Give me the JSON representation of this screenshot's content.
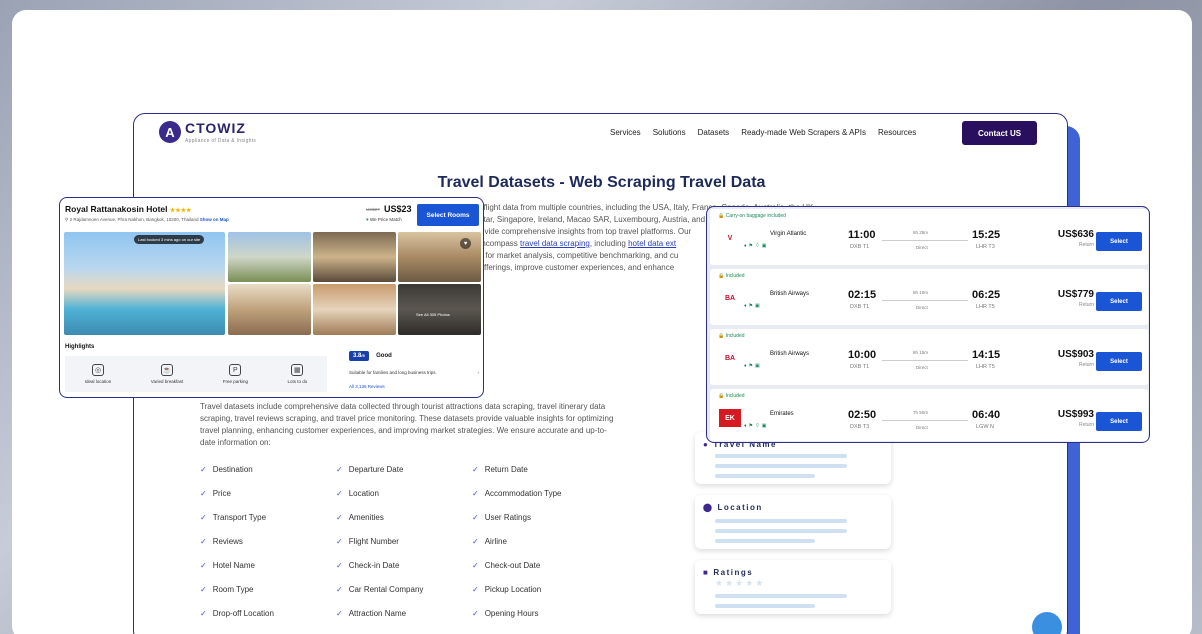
{
  "nav": {
    "logo_mark": "A",
    "logo_name": "CTOWIZ",
    "logo_tagline": "Appliance of Data & Insights",
    "links": [
      "Services",
      "Solutions",
      "Datasets",
      "Ready-made Web Scrapers & APIs",
      "Resources"
    ],
    "cta": "Contact US"
  },
  "page": {
    "title": "Travel Datasets - Web Scraping Travel Data",
    "intro_1": "l and flight data from multiple countries, including the USA, Italy, France, Canada, Australia, the UK,",
    "intro_2": "d, Qatar, Singapore, Ireland, Macao SAR, Luxembourg, Austria, and more. These datasets, created using",
    "intro_3_link": "a",
    "intro_3": ", provide comprehensive insights from top travel platforms. Our",
    "intro_4_pre": "ets encompass ",
    "intro_4_link1": "travel data scraping",
    "intro_4_mid": ", including ",
    "intro_4_link2": "hotel data ext",
    "intro_5": "rucial for market analysis, competitive benchmarking, and cu",
    "intro_6": "heir offerings, improve customer experiences, and enhance",
    "description": "Travel datasets include comprehensive data collected through tourist attractions data scraping, travel itinerary data scraping, travel reviews scraping, and travel price monitoring. These datasets provide valuable insights for optimizing travel planning, enhancing customer experiences, and improving market strategies. We ensure accurate and up-to-date information on:",
    "fields": [
      "Destination",
      "Departure Date",
      "Return Date",
      "Price",
      "Location",
      "Accommodation Type",
      "Transport Type",
      "Amenities",
      "User Ratings",
      "Reviews",
      "Flight Number",
      "Airline",
      "Hotel Name",
      "Check-in Date",
      "Check-out Date",
      "Room Type",
      "Car Rental Company",
      "Pickup Location",
      "Drop-off Location",
      "Attraction Name",
      "Opening Hours"
    ]
  },
  "hotel": {
    "name": "Royal Rattanakosin Hotel",
    "stars": "★★★★",
    "address": "2 Rajdamnoen Avenue, Phra Nakhon, Bangkok, 10200, Thailand",
    "map_link": "Show on Map",
    "price_old": "US$27",
    "price": "US$23",
    "price_match": "We Price Match",
    "select_label": "Select Rooms",
    "last_booked": "Last booked 3 mins ago on our site",
    "see_all": "See All 305 Photos",
    "highlights_title": "Highlights",
    "highlights": [
      {
        "icon": "location-pin-icon",
        "glyph": "◎",
        "label": "Ideal location"
      },
      {
        "icon": "breakfast-icon",
        "glyph": "☕",
        "label": "Varied breakfast"
      },
      {
        "icon": "parking-icon",
        "glyph": "P",
        "label": "Free parking"
      },
      {
        "icon": "activities-icon",
        "glyph": "▦",
        "label": "Lots to do"
      }
    ],
    "rating_score": "3.8",
    "rating_max": "/5",
    "rating_word": "Good",
    "rating_desc": "Suitable for families and long business trips.",
    "rating_link": "All 3,136 Reviews"
  },
  "flights": [
    {
      "badge": "Carry-on baggage included",
      "airline": "Virgin Atlantic",
      "logo": "V",
      "logo_color": "#d0102b",
      "dep": "11:00",
      "dep_ap": "DXB T1",
      "duration": "6h 25m",
      "stops": "Direct",
      "arr": "15:25",
      "arr_ap": "LHR T3",
      "price": "US$636",
      "trip": "Return",
      "select": "Select"
    },
    {
      "badge": "Included",
      "airline": "British Airways",
      "logo": "BA",
      "logo_color": "#c8102e",
      "dep": "02:15",
      "dep_ap": "DXB T1",
      "duration": "8h 10m",
      "stops": "Direct",
      "arr": "06:25",
      "arr_ap": "LHR T5",
      "price": "US$779",
      "trip": "Return",
      "select": "Select"
    },
    {
      "badge": "Included",
      "airline": "British Airways",
      "logo": "BA",
      "logo_color": "#c8102e",
      "dep": "10:00",
      "dep_ap": "DXB T1",
      "duration": "8h 15m",
      "stops": "Direct",
      "arr": "14:15",
      "arr_ap": "LHR T5",
      "price": "US$903",
      "trip": "Return",
      "select": "Select"
    },
    {
      "badge": "Included",
      "airline": "Emirates",
      "logo": "EK",
      "logo_color": "#d71921",
      "dep": "02:50",
      "dep_ap": "DXB T3",
      "duration": "7h 50m",
      "stops": "Direct",
      "arr": "06:40",
      "arr_ap": "LGW N",
      "price": "US$993",
      "trip": "Return",
      "select": "Select"
    }
  ],
  "widgets": {
    "travel_name": "Travel Name",
    "location": "Location",
    "ratings": "Ratings",
    "stars": "★★★★★"
  },
  "colors": {
    "brand": "#2a0f5e",
    "accent": "#1a55d6",
    "frame": "#2b2f8a"
  }
}
